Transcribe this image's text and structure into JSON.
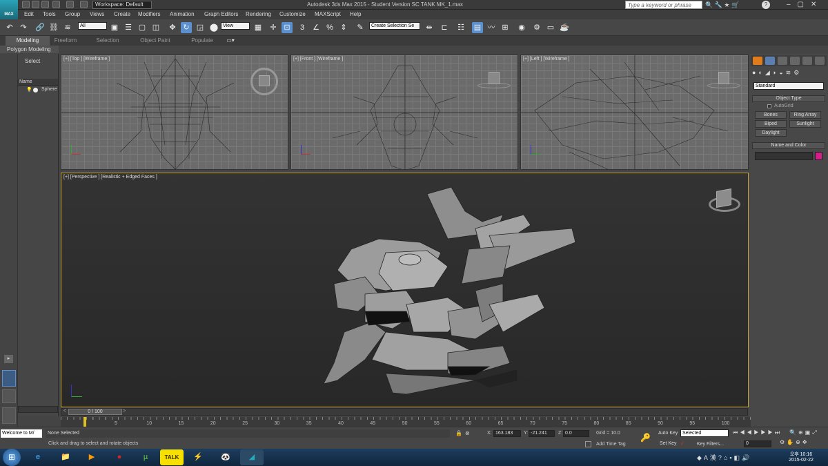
{
  "app": {
    "logo_text": "MAX",
    "workspace": "Workspace: Default",
    "window_title": "Autodesk 3ds Max  2015  - Student Version    SC TANK MK_1.max",
    "search_placeholder": "Type a keyword or phrase"
  },
  "menu": [
    "Edit",
    "Tools",
    "Group",
    "Views",
    "Create",
    "Modifiers",
    "Animation",
    "Graph Editors",
    "Rendering",
    "Customize",
    "MAXScript",
    "Help"
  ],
  "toolbar": {
    "selection_filter": "All",
    "ref_coord": "View",
    "named_selection": "Create Selection Se"
  },
  "ribbon": {
    "tabs": [
      "Modeling",
      "Freeform",
      "Selection",
      "Object Paint",
      "Populate"
    ],
    "active": "Modeling",
    "sub": "Polygon Modeling"
  },
  "explorer": {
    "select_label": "Select",
    "name_header": "Name",
    "item": "Sphere"
  },
  "viewports": {
    "top": "[+] [Top ] [Wireframe ]",
    "front": "[+] [Front ] [Wireframe ]",
    "left": "[+] [Left ] [Wireframe ]",
    "perspective": "[+] [Perspective ] [Realistic + Edged Faces ]"
  },
  "command_panel": {
    "category": "Standard",
    "object_type": "Object Type",
    "autogrid": "AutoGrid",
    "buttons": [
      "Bones",
      "Ring Array",
      "Biped",
      "Sunlight",
      "Daylight"
    ],
    "name_and_color": "Name and Color",
    "swatch_color": "#d41e8a"
  },
  "timeline": {
    "frame": "0 / 100",
    "ticks": [
      "5",
      "10",
      "15",
      "20",
      "25",
      "30",
      "35",
      "40",
      "45",
      "50",
      "55",
      "60",
      "65",
      "70",
      "75",
      "80",
      "85",
      "90",
      "95",
      "100"
    ]
  },
  "status": {
    "maxscript": "Welcome to M/",
    "selection": "None Selected",
    "prompt": "Click and drag to select and rotate objects",
    "x_label": "X:",
    "x": "163.183",
    "y_label": "Y:",
    "y": "-21.241",
    "z_label": "Z:",
    "z": "0.0",
    "grid": "Grid = 10.0",
    "add_time_tag": "Add Time Tag",
    "auto_key": "Auto Key",
    "set_key": "Set Key",
    "key_mode": "Selected",
    "key_filters": "Key Filters...",
    "current_frame": "0"
  },
  "taskbar": {
    "time": "오후 10:16",
    "date": "2015-02-22"
  }
}
